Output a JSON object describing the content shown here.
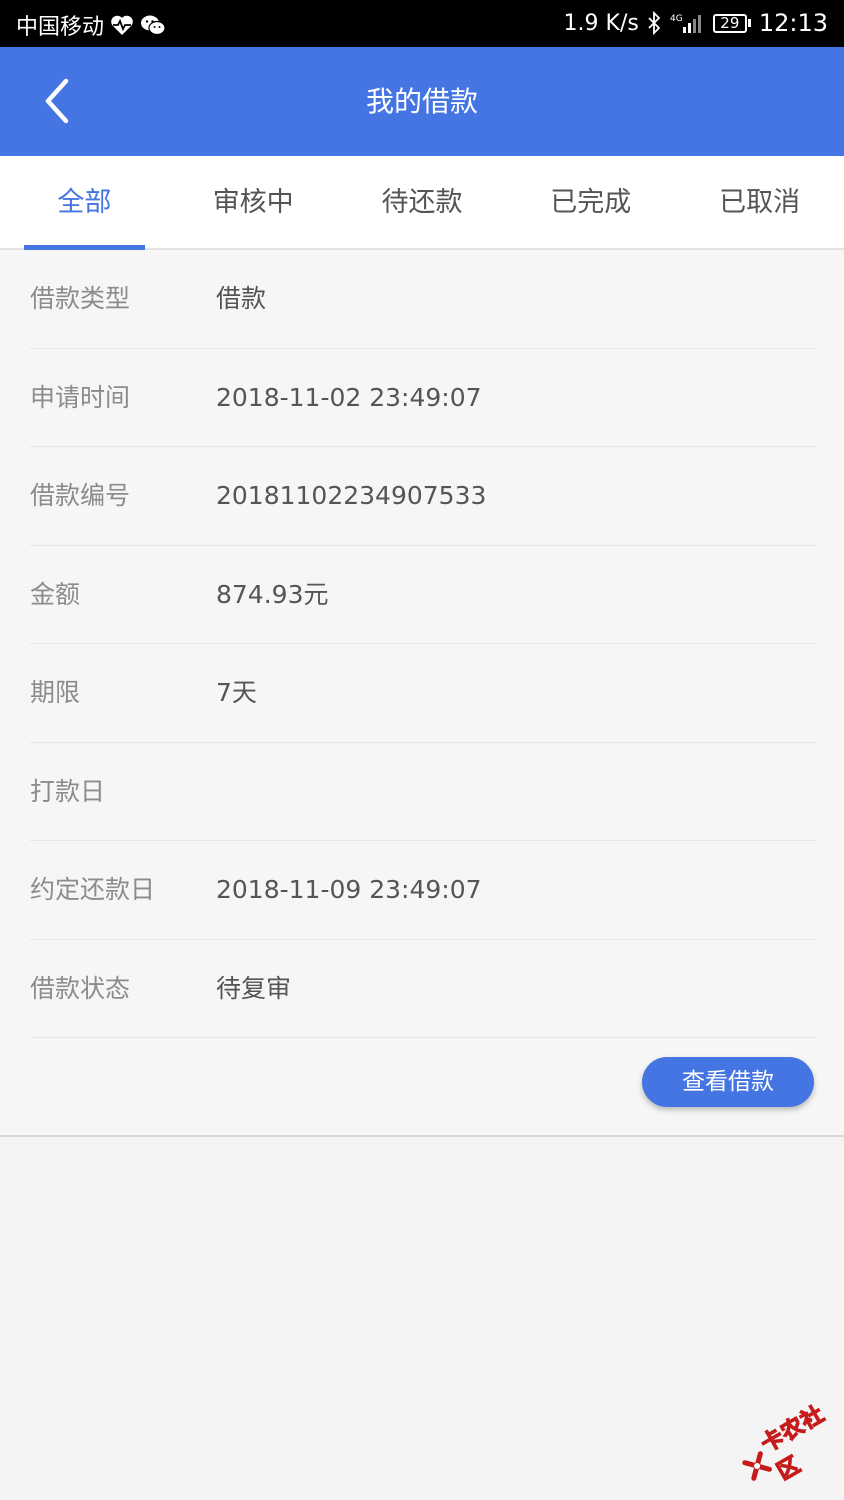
{
  "status_bar": {
    "carrier": "中国移动",
    "net_speed": "1.9 K/s",
    "network": "4G",
    "battery": "29",
    "time": "12:13"
  },
  "header": {
    "title": "我的借款",
    "back_icon": "chevron-left-icon"
  },
  "tabs": [
    {
      "label": "全部",
      "active": true
    },
    {
      "label": "审核中",
      "active": false
    },
    {
      "label": "待还款",
      "active": false
    },
    {
      "label": "已完成",
      "active": false
    },
    {
      "label": "已取消",
      "active": false
    }
  ],
  "details": [
    {
      "label": "借款类型",
      "value": "借款"
    },
    {
      "label": "申请时间",
      "value": "2018-11-02 23:49:07"
    },
    {
      "label": "借款编号",
      "value": "20181102234907533"
    },
    {
      "label": "金额",
      "value": "874.93元"
    },
    {
      "label": "期限",
      "value": "7天"
    },
    {
      "label": "打款日",
      "value": ""
    },
    {
      "label": "约定还款日",
      "value": "2018-11-09 23:49:07"
    },
    {
      "label": "借款状态",
      "value": "待复审"
    }
  ],
  "actions": {
    "view_loan_label": "查看借款"
  },
  "watermark": {
    "text": "卡农社区"
  },
  "colors": {
    "accent": "#4575e2",
    "background": "#f4f4f4",
    "label": "#8c8c8c",
    "value": "#555555"
  }
}
